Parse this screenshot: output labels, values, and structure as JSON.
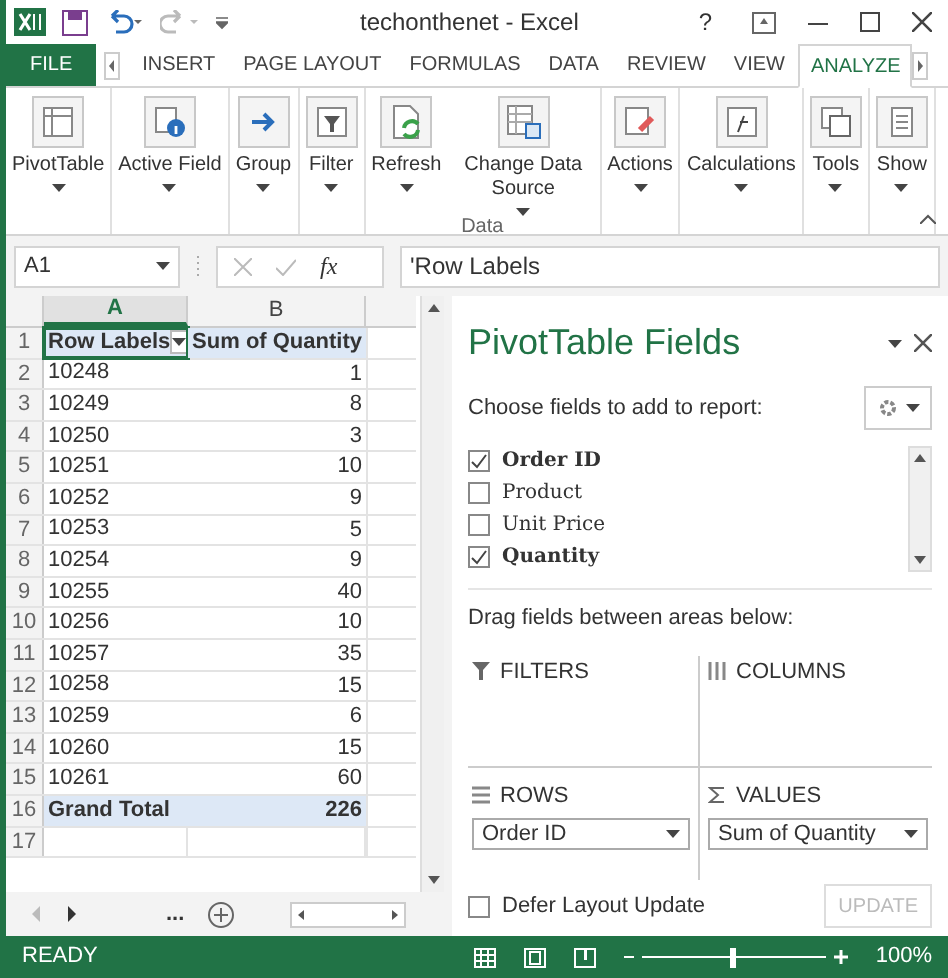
{
  "window": {
    "title": "techonthenet - Excel",
    "help": "?"
  },
  "tabs": [
    {
      "label": "FILE",
      "kind": "file",
      "selected": false
    },
    {
      "label": "INSERT",
      "kind": "tab",
      "selected": false
    },
    {
      "label": "PAGE LAYOUT",
      "kind": "tab",
      "selected": false
    },
    {
      "label": "FORMULAS",
      "kind": "tab",
      "selected": false
    },
    {
      "label": "DATA",
      "kind": "tab",
      "selected": false
    },
    {
      "label": "REVIEW",
      "kind": "tab",
      "selected": false
    },
    {
      "label": "VIEW",
      "kind": "tab",
      "selected": false
    },
    {
      "label": "ANALYZE",
      "kind": "tab",
      "selected": true
    }
  ],
  "ribbon": {
    "buttons": [
      {
        "label": "PivotTable"
      },
      {
        "label": "Active Field"
      },
      {
        "label": "Group"
      },
      {
        "label": "Filter"
      },
      {
        "label": "Refresh"
      },
      {
        "label": "Change Data Source"
      },
      {
        "label": "Actions"
      },
      {
        "label": "Calculations"
      },
      {
        "label": "Tools"
      },
      {
        "label": "Show"
      }
    ],
    "group_label": "Data"
  },
  "formula_bar": {
    "name_box": "A1",
    "fx": "fx",
    "value": "'Row Labels"
  },
  "sheet": {
    "columns": [
      {
        "label": "A",
        "selected": true
      },
      {
        "label": "B",
        "selected": false
      }
    ],
    "rows": [
      {
        "number": "1",
        "kind": "header",
        "label": "Row Labels",
        "value": "Sum of Quantity"
      },
      {
        "number": "2",
        "kind": "data",
        "label": "10248",
        "value": "1"
      },
      {
        "number": "3",
        "kind": "data",
        "label": "10249",
        "value": "8"
      },
      {
        "number": "4",
        "kind": "data",
        "label": "10250",
        "value": "3"
      },
      {
        "number": "5",
        "kind": "data",
        "label": "10251",
        "value": "10"
      },
      {
        "number": "6",
        "kind": "data",
        "label": "10252",
        "value": "9"
      },
      {
        "number": "7",
        "kind": "data",
        "label": "10253",
        "value": "5"
      },
      {
        "number": "8",
        "kind": "data",
        "label": "10254",
        "value": "9"
      },
      {
        "number": "9",
        "kind": "data",
        "label": "10255",
        "value": "40"
      },
      {
        "number": "10",
        "kind": "data",
        "label": "10256",
        "value": "10"
      },
      {
        "number": "11",
        "kind": "data",
        "label": "10257",
        "value": "35"
      },
      {
        "number": "12",
        "kind": "data",
        "label": "10258",
        "value": "15"
      },
      {
        "number": "13",
        "kind": "data",
        "label": "10259",
        "value": "6"
      },
      {
        "number": "14",
        "kind": "data",
        "label": "10260",
        "value": "15"
      },
      {
        "number": "15",
        "kind": "data",
        "label": "10261",
        "value": "60"
      },
      {
        "number": "16",
        "kind": "total",
        "label": "Grand Total",
        "value": "226"
      },
      {
        "number": "17",
        "kind": "empty"
      }
    ],
    "sheet_tabs_more": "..."
  },
  "panel": {
    "title": "PivotTable Fields",
    "subtitle": "Choose fields to add to report:",
    "fields": [
      {
        "label": "Order ID",
        "checked": true
      },
      {
        "label": "Product",
        "checked": false
      },
      {
        "label": "Unit Price",
        "checked": false
      },
      {
        "label": "Quantity",
        "checked": true
      }
    ],
    "drag_label": "Drag fields between areas below:",
    "areas": [
      {
        "label": "FILTERS",
        "kind": "filter"
      },
      {
        "label": "COLUMNS",
        "kind": "columns"
      },
      {
        "label": "ROWS",
        "kind": "rows",
        "items": [
          "Order ID"
        ]
      },
      {
        "label": "VALUES",
        "kind": "sigma",
        "items": [
          "Sum of Quantity"
        ]
      }
    ],
    "defer": {
      "label": "Defer Layout Update",
      "checked": false
    },
    "update": {
      "label": "UPDATE",
      "disabled": true
    }
  },
  "status_bar": {
    "status": "READY",
    "zoom": {
      "level": 0.5,
      "reading": "100%"
    }
  }
}
